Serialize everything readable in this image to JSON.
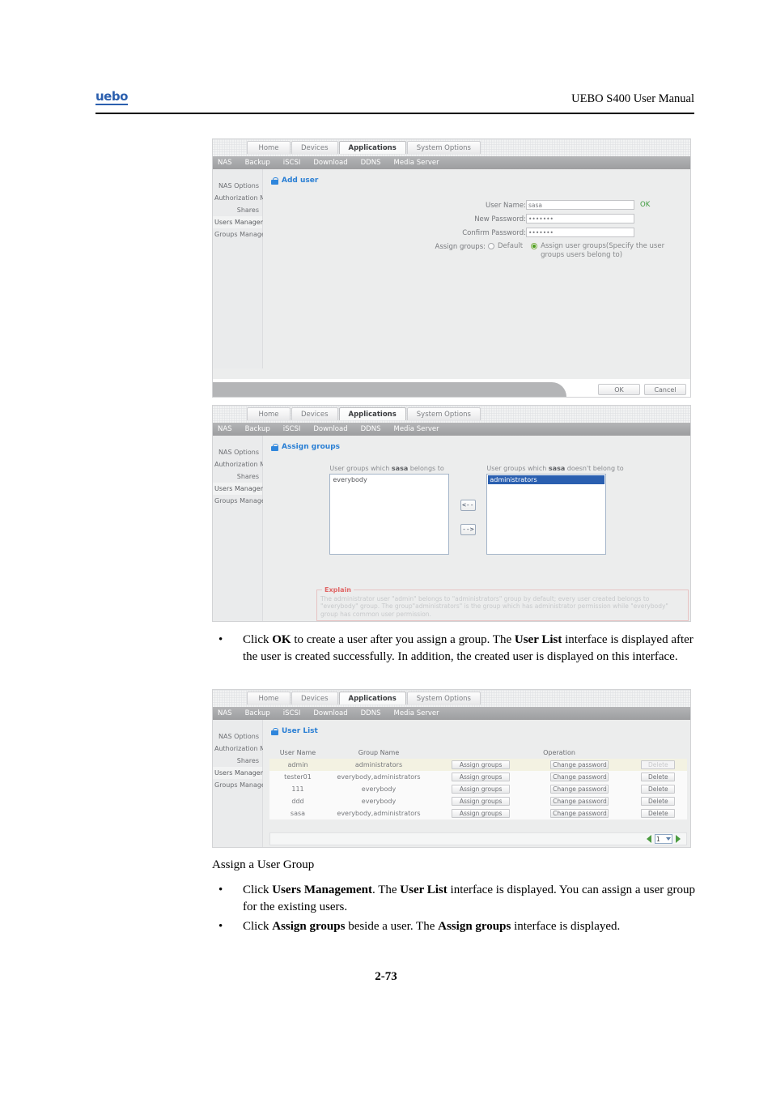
{
  "page": {
    "logo": "uebo",
    "header_title": "UEBO S400 User Manual",
    "page_number": "2-73"
  },
  "shot1": {
    "tabs": [
      "Home",
      "Devices",
      "Applications",
      "System Options"
    ],
    "active_tab": "Applications",
    "subnav": [
      "NAS",
      "Backup",
      "iSCSI",
      "Download",
      "DDNS",
      "Media Server"
    ],
    "active_subnav": "NAS",
    "sidebar": [
      "NAS Options",
      "Authorization Mode",
      "Shares",
      "Users Management",
      "Groups Management"
    ],
    "selected_sidebar": "Users Management",
    "panel_title": "Add user",
    "fields": {
      "user_name_label": "User Name:",
      "user_name_value": "sasa",
      "user_name_status": "OK",
      "new_password_label": "New Password:",
      "new_password_value": "•••••••",
      "confirm_password_label": "Confirm Password:",
      "confirm_password_value": "•••••••",
      "assign_groups_label": "Assign groups:",
      "radio_default": "Default",
      "radio_assign": "Assign user groups(Specify the user groups users belong to)"
    },
    "buttons": {
      "ok": "OK",
      "cancel": "Cancel"
    }
  },
  "shot2": {
    "tabs": [
      "Home",
      "Devices",
      "Applications",
      "System Options"
    ],
    "active_tab": "Applications",
    "subnav": [
      "NAS",
      "Backup",
      "iSCSI",
      "Download",
      "DDNS",
      "Media Server"
    ],
    "active_subnav": "NAS",
    "sidebar": [
      "NAS Options",
      "Authorization Mode",
      "Shares",
      "Users Management",
      "Groups Management"
    ],
    "selected_sidebar": "Users Management",
    "panel_title": "Assign groups",
    "left_list": {
      "label_pre": "User groups which ",
      "label_user": "sasa",
      "label_post": " belongs to",
      "options": [
        "everybody"
      ]
    },
    "right_list": {
      "label_pre": "User groups which ",
      "label_user": "sasa",
      "label_post": " doesn't belong to",
      "options": [
        "administrators"
      ],
      "selected": "administrators"
    },
    "arrow_left": "<--",
    "arrow_right": "-->",
    "explain_legend": "Explain",
    "explain_text": "The administrator user \"admin\" belongs to \"administrators\" group by default; every user created belongs to \"everybody\" group. The group\"administrators\" is the group which has administrator permission while \"everybody\" group has common user permission."
  },
  "shot3": {
    "tabs": [
      "Home",
      "Devices",
      "Applications",
      "System Options"
    ],
    "active_tab": "Applications",
    "subnav": [
      "NAS",
      "Backup",
      "iSCSI",
      "Download",
      "DDNS",
      "Media Server"
    ],
    "active_subnav": "NAS",
    "sidebar": [
      "NAS Options",
      "Authorization Mode",
      "Shares",
      "Users Management",
      "Groups Management"
    ],
    "selected_sidebar": "Users Management",
    "panel_title": "User List",
    "table": {
      "headers": [
        "User Name",
        "Group Name",
        "Operation"
      ],
      "rows": [
        {
          "user": "admin",
          "group": "administrators",
          "assign": "Assign groups",
          "change": "Change password",
          "delete": "Delete",
          "delete_disabled": true,
          "highlight": true
        },
        {
          "user": "tester01",
          "group": "everybody,administrators",
          "assign": "Assign groups",
          "change": "Change password",
          "delete": "Delete",
          "delete_disabled": false,
          "highlight": false
        },
        {
          "user": "111",
          "group": "everybody",
          "assign": "Assign groups",
          "change": "Change password",
          "delete": "Delete",
          "delete_disabled": false,
          "highlight": false
        },
        {
          "user": "ddd",
          "group": "everybody",
          "assign": "Assign groups",
          "change": "Change password",
          "delete": "Delete",
          "delete_disabled": false,
          "highlight": false
        },
        {
          "user": "sasa",
          "group": "everybody,administrators",
          "assign": "Assign groups",
          "change": "Change password",
          "delete": "Delete",
          "delete_disabled": false,
          "highlight": false
        }
      ]
    },
    "pager": {
      "page_value": "1"
    }
  },
  "body_text": {
    "para1": {
      "bullet": "•",
      "segments": [
        {
          "t": "Click ",
          "b": false
        },
        {
          "t": "OK",
          "b": true
        },
        {
          "t": " to create a user after you assign a group. The ",
          "b": false
        },
        {
          "t": "User List",
          "b": true
        },
        {
          "t": " interface is displayed after the user is created successfully. In addition, the created user is displayed on this interface.",
          "b": false
        }
      ]
    },
    "heading1": "Assign a User Group",
    "para2": {
      "bullet": "•",
      "segments": [
        {
          "t": "Click ",
          "b": false
        },
        {
          "t": "Users Management",
          "b": true
        },
        {
          "t": ". The ",
          "b": false
        },
        {
          "t": "User List",
          "b": true
        },
        {
          "t": " interface is displayed. You can assign a user group for the existing users.",
          "b": false
        }
      ]
    },
    "para3": {
      "bullet": "•",
      "segments": [
        {
          "t": "Click ",
          "b": false
        },
        {
          "t": "Assign groups",
          "b": true
        },
        {
          "t": " beside a user. The ",
          "b": false
        },
        {
          "t": "Assign groups",
          "b": true
        },
        {
          "t": " interface is displayed.",
          "b": false
        }
      ]
    }
  }
}
